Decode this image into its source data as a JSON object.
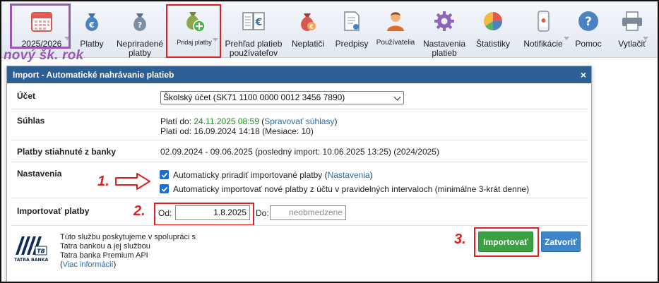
{
  "toolbar": {
    "items": [
      {
        "label": "2025/2026",
        "icon": "calendar-icon",
        "caret": true
      },
      {
        "label": "Platby",
        "icon": "money-bag-euro-icon",
        "caret": false
      },
      {
        "label": "Nepriradené platby",
        "icon": "money-bag-icon",
        "caret": false
      },
      {
        "label": "Pridaj platby",
        "icon": "money-bag-add-icon",
        "caret": true
      },
      {
        "label": "Prehľad platieb používateľov",
        "icon": "ledger-euro-icon",
        "caret": false
      },
      {
        "label": "Neplatiči",
        "icon": "money-bag-debt-icon",
        "caret": false
      },
      {
        "label": "Predpisy",
        "icon": "document-icon",
        "caret": false
      },
      {
        "label": "Používatelia",
        "icon": "user-icon",
        "caret": false
      },
      {
        "label": "Nastavenia platieb",
        "icon": "gear-icon",
        "caret": false
      },
      {
        "label": "Štatistiky",
        "icon": "pie-chart-icon",
        "caret": false
      },
      {
        "label": "Notifikácie",
        "icon": "phone-notification-icon",
        "caret": true
      },
      {
        "label": "Pomoc",
        "icon": "help-icon",
        "caret": false
      },
      {
        "label": "Vytlačiť",
        "icon": "printer-icon",
        "caret": true
      }
    ]
  },
  "annotations": {
    "year_note": "nový šk. rok",
    "step1": "1.",
    "step2": "2.",
    "step3": "3."
  },
  "dialog": {
    "title": "Import - Automatické nahrávanie platieb",
    "close": "×",
    "ucet_label": "Účet",
    "ucet_value": "Školský účet (SK71 1100 0000 0012 3456 7890)",
    "suhlas_label": "Súhlas",
    "suhlas_plati_do_prefix": "Platí do: ",
    "suhlas_plati_do_value": "24.11.2025 08:59",
    "suhlas_open": " (",
    "suhlas_link": "Spravovať súhlasy",
    "suhlas_close": ")",
    "suhlas_plati_od": "Platí od: 16.09.2024 14:18 (Mesiace: 10)",
    "stiahnute_label": "Platby stiahnuté z banky",
    "stiahnute_value": "02.09.2024 - 09.06.2025 (posledný import: 10.06.2025 13:25) (2024/2025)",
    "nastavenia_label": "Nastavenia",
    "cb1_text": "Automaticky priradiť importované platby (",
    "cb1_link": "Nastavenia",
    "cb1_end": ")",
    "cb2_text": "Automaticky importovať nové platby z účtu v pravidelných intervaloch (minimálne 3-krát denne)",
    "import_label": "Importovať platby",
    "od_label": "Od:",
    "od_value": "1.8.2025",
    "do_label": "Do:",
    "do_placeholder": "neobmedzene",
    "footer_line1": "Túto službu poskytujeme v spolupráci s",
    "footer_line2": "Tatra bankou a jej službou",
    "footer_line3": "Tatra banka Premium API",
    "footer_link": "Viac informácií",
    "bank_logo_text": "TATRA BANKA",
    "import_button": "Importovať",
    "close_button": "Zatvoriť",
    "partial_text": "..."
  },
  "colors": {
    "header_blue": "#2e5f94",
    "accent_green": "#3aa043",
    "button_blue": "#3f86c8",
    "annotation_red": "#e02020",
    "annotation_purple": "#9a58b6"
  }
}
